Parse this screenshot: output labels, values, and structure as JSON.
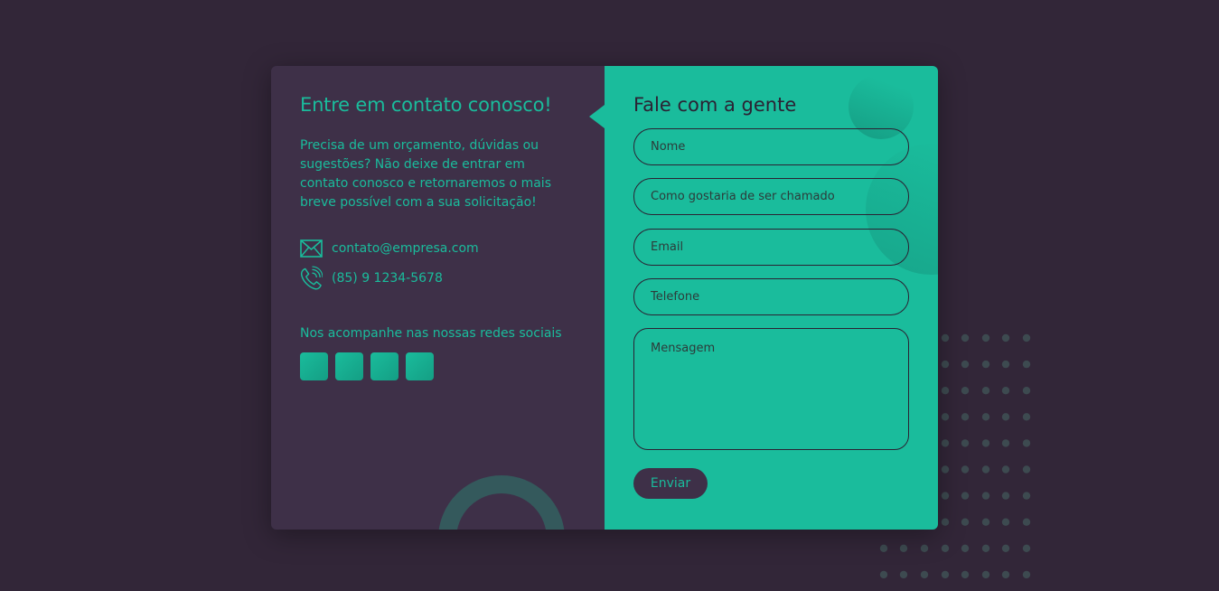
{
  "info": {
    "title": "Entre em contato conosco!",
    "description": "Precisa de um orçamento, dúvidas ou sugestões? Não deixe de entrar em contato conosco e retornaremos o mais breve possível com a sua solicitação!",
    "email": "contato@empresa.com",
    "phone": "(85) 9 1234-5678",
    "social_title": "Nos acompanhe nas nossas redes sociais",
    "social_count": 4,
    "email_icon": "mail-icon",
    "phone_icon": "phone-icon"
  },
  "form": {
    "title": "Fale com a gente",
    "name_placeholder": "Nome",
    "nickname_placeholder": "Como gostaria de ser chamado",
    "email_placeholder": "Email",
    "phone_placeholder": "Telefone",
    "message_placeholder": "Mensagem",
    "submit_label": "Enviar"
  },
  "colors": {
    "background": "#322638",
    "panel_left": "#3e3048",
    "accent": "#1abc9c",
    "dark_text": "#2b2233"
  }
}
